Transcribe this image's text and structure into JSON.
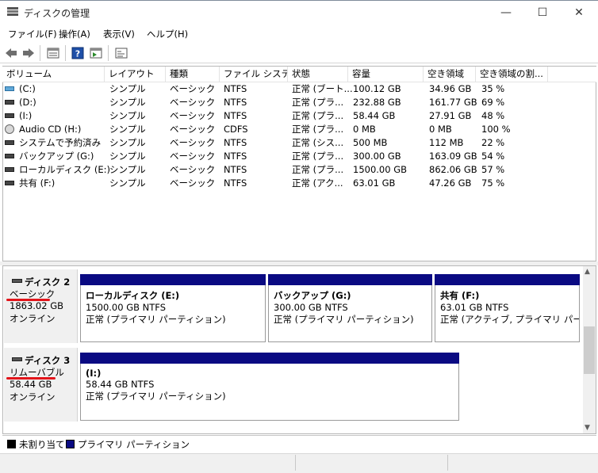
{
  "window": {
    "title": "ディスクの管理",
    "minimize_glyph": "—",
    "maximize_glyph": "☐",
    "close_glyph": "✕"
  },
  "menu": [
    "ファイル(F)",
    "操作(A)",
    "表示(V)",
    "ヘルプ(H)"
  ],
  "toolbar_icons": [
    "back-arrow-icon",
    "forward-arrow-icon",
    "properties-icon",
    "help-icon",
    "action-pane-icon",
    "console-icon"
  ],
  "columns": [
    "ボリューム",
    "レイアウト",
    "種類",
    "ファイル システム",
    "状態",
    "容量",
    "空き領域",
    "空き領域の割..."
  ],
  "volumes": [
    {
      "icon": "c-drive-icon",
      "name": "(C:)",
      "layout": "シンプル",
      "type": "ベーシック",
      "fs": "NTFS",
      "status": "正常 (ブート...",
      "capacity": "100.12 GB",
      "free": "34.96 GB",
      "pct": "35 %"
    },
    {
      "icon": "drive-icon",
      "name": "(D:)",
      "layout": "シンプル",
      "type": "ベーシック",
      "fs": "NTFS",
      "status": "正常 (プラ...",
      "capacity": "232.88 GB",
      "free": "161.77 GB",
      "pct": "69 %"
    },
    {
      "icon": "drive-icon",
      "name": "(I:)",
      "layout": "シンプル",
      "type": "ベーシック",
      "fs": "NTFS",
      "status": "正常 (プラ...",
      "capacity": "58.44 GB",
      "free": "27.91 GB",
      "pct": "48 %"
    },
    {
      "icon": "cd-icon",
      "name": "Audio CD (H:)",
      "layout": "シンプル",
      "type": "ベーシック",
      "fs": "CDFS",
      "status": "正常 (プラ...",
      "capacity": "0 MB",
      "free": "0 MB",
      "pct": "100 %"
    },
    {
      "icon": "drive-icon",
      "name": "システムで予約済み",
      "layout": "シンプル",
      "type": "ベーシック",
      "fs": "NTFS",
      "status": "正常 (シス...",
      "capacity": "500 MB",
      "free": "112 MB",
      "pct": "22 %"
    },
    {
      "icon": "drive-icon",
      "name": "バックアップ (G:)",
      "layout": "シンプル",
      "type": "ベーシック",
      "fs": "NTFS",
      "status": "正常 (プラ...",
      "capacity": "300.00 GB",
      "free": "163.09 GB",
      "pct": "54 %"
    },
    {
      "icon": "drive-icon",
      "name": "ローカルディスク (E:)",
      "layout": "シンプル",
      "type": "ベーシック",
      "fs": "NTFS",
      "status": "正常 (プラ...",
      "capacity": "1500.00 GB",
      "free": "862.06 GB",
      "pct": "57 %"
    },
    {
      "icon": "drive-icon",
      "name": "共有 (F:)",
      "layout": "シンプル",
      "type": "ベーシック",
      "fs": "NTFS",
      "status": "正常 (アク...",
      "capacity": "63.01 GB",
      "free": "47.26 GB",
      "pct": "75 %"
    }
  ],
  "disks": [
    {
      "title": "ディスク 2",
      "kind": "ベーシック",
      "size": "1863.02 GB",
      "state": "オンライン",
      "partitions": [
        {
          "name": "ローカルディスク (E:)",
          "size": "1500.00 GB NTFS",
          "status": "正常 (プライマリ パーティション)"
        },
        {
          "name": "バックアップ (G:)",
          "size": "300.00 GB NTFS",
          "status": "正常 (プライマリ パーティション)"
        },
        {
          "name": "共有 (F:)",
          "size": "63.01 GB NTFS",
          "status": "正常 (アクティブ, プライマリ パーティシ"
        }
      ]
    },
    {
      "title": "ディスク 3",
      "kind": "リムーバブル",
      "size": "58.44 GB",
      "state": "オンライン",
      "partitions": [
        {
          "name": "(I:)",
          "size": "58.44 GB NTFS",
          "status": "正常 (プライマリ パーティション)"
        }
      ]
    }
  ],
  "legend": {
    "unallocated": "未割り当て",
    "primary": "プライマリ パーティション",
    "unallocated_color": "#000000",
    "primary_color": "#0a0a82"
  },
  "annotation_color": "#e2141a"
}
